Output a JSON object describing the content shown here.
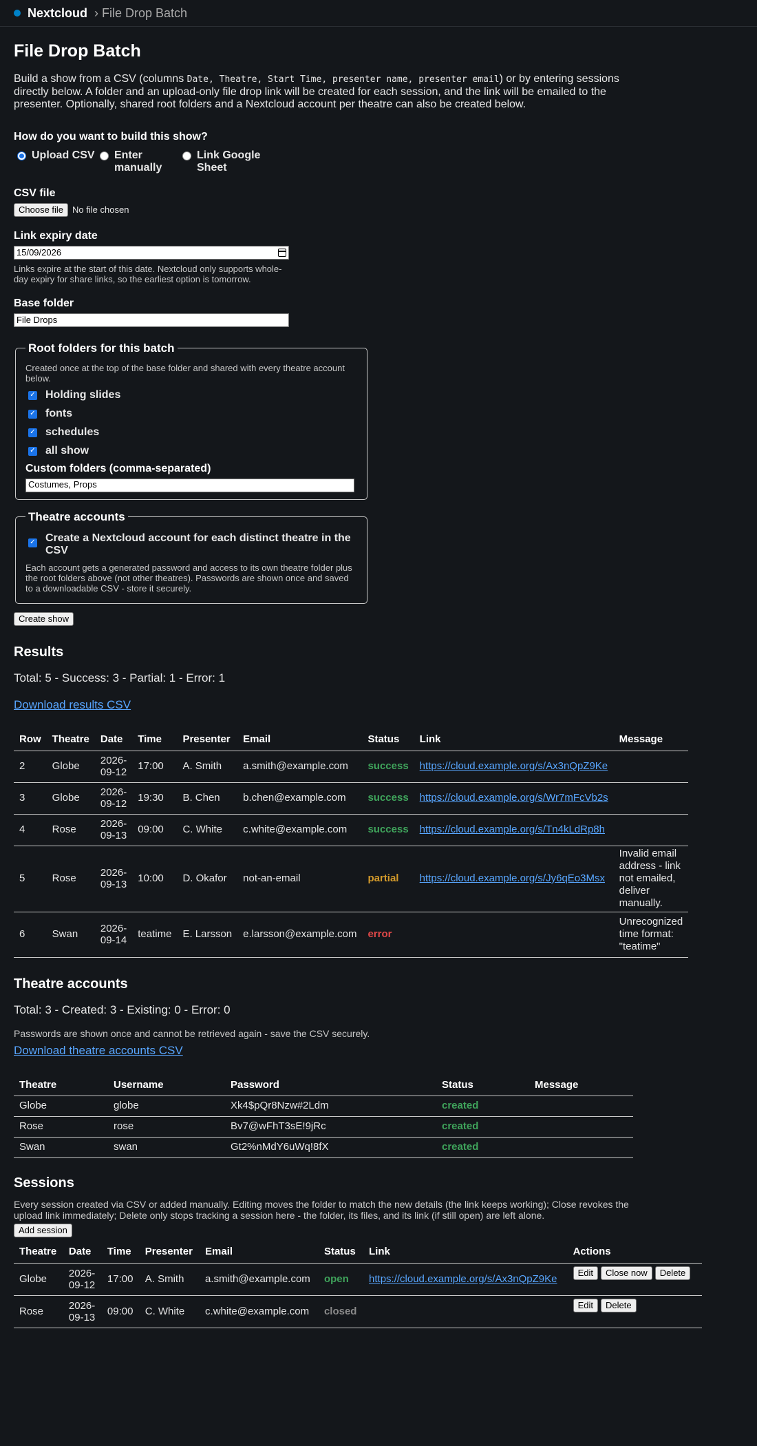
{
  "topbar": {
    "brand": "Nextcloud",
    "crumb": "› File Drop Batch"
  },
  "page": {
    "title": "File Drop Batch",
    "intro_a": "Build a show from a CSV (columns ",
    "intro_code": "Date, Theatre, Start Time, presenter name, presenter email",
    "intro_b": ") or by entering sessions directly below. A folder and an upload-only file drop link will be created for each session, and the link will be emailed to the presenter. Optionally, shared root folders and a Nextcloud account per theatre can also be created below."
  },
  "build": {
    "question": "How do you want to build this show?",
    "options": [
      {
        "label": "Upload CSV",
        "selected": true
      },
      {
        "label": "Enter manually",
        "selected": false
      },
      {
        "label": "Link Google Sheet",
        "selected": false
      }
    ]
  },
  "csv": {
    "label": "CSV file",
    "button": "Choose file",
    "status": "No file chosen"
  },
  "expiry": {
    "label": "Link expiry date",
    "value": "15/09/2026",
    "hint": "Links expire at the start of this date. Nextcloud only supports whole-day expiry for share links, so the earliest option is tomorrow."
  },
  "base": {
    "label": "Base folder",
    "value": "File Drops"
  },
  "roots": {
    "legend": "Root folders for this batch",
    "hint": "Created once at the top of the base folder and shared with every theatre account below.",
    "folders": [
      "Holding slides",
      "fonts",
      "schedules",
      "all show"
    ],
    "custom_label": "Custom folders (comma-separated)",
    "custom_value": "Costumes, Props"
  },
  "accounts_box": {
    "legend": "Theatre accounts",
    "checkbox": "Create a Nextcloud account for each distinct theatre in the CSV",
    "hint": "Each account gets a generated password and access to its own theatre folder plus the root folders above (not other theatres). Passwords are shown once and saved to a downloadable CSV - store it securely."
  },
  "create_button": "Create show",
  "results": {
    "title": "Results",
    "totals": "Total: 5 - Success: 3 - Partial: 1 - Error: 1",
    "download": "Download results CSV",
    "headers": [
      "Row",
      "Theatre",
      "Date",
      "Time",
      "Presenter",
      "Email",
      "Status",
      "Link",
      "Message"
    ],
    "rows": [
      {
        "row": "2",
        "theatre": "Globe",
        "date": "2026-09-12",
        "time": "17:00",
        "presenter": "A. Smith",
        "email": "a.smith@example.com",
        "status": "success",
        "link": "https://cloud.example.org/s/Ax3nQpZ9Ke",
        "message": ""
      },
      {
        "row": "3",
        "theatre": "Globe",
        "date": "2026-09-12",
        "time": "19:30",
        "presenter": "B. Chen",
        "email": "b.chen@example.com",
        "status": "success",
        "link": "https://cloud.example.org/s/Wr7mFcVb2s",
        "message": ""
      },
      {
        "row": "4",
        "theatre": "Rose",
        "date": "2026-09-13",
        "time": "09:00",
        "presenter": "C. White",
        "email": "c.white@example.com",
        "status": "success",
        "link": "https://cloud.example.org/s/Tn4kLdRp8h",
        "message": ""
      },
      {
        "row": "5",
        "theatre": "Rose",
        "date": "2026-09-13",
        "time": "10:00",
        "presenter": "D. Okafor",
        "email": "not-an-email",
        "status": "partial",
        "link": "https://cloud.example.org/s/Jy6qEo3Msx",
        "message": "Invalid email address - link not emailed, deliver manually."
      },
      {
        "row": "6",
        "theatre": "Swan",
        "date": "2026-09-14",
        "time": "teatime",
        "presenter": "E. Larsson",
        "email": "e.larsson@example.com",
        "status": "error",
        "link": "",
        "message": "Unrecognized time format: \"teatime\""
      }
    ]
  },
  "accounts": {
    "title": "Theatre accounts",
    "totals": "Total: 3 - Created: 3 - Existing: 0 - Error: 0",
    "note": "Passwords are shown once and cannot be retrieved again - save the CSV securely.",
    "download": "Download theatre accounts CSV",
    "headers": [
      "Theatre",
      "Username",
      "Password",
      "Status",
      "Message"
    ],
    "rows": [
      {
        "theatre": "Globe",
        "username": "globe",
        "password": "Xk4$pQr8Nzw#2Ldm",
        "status": "created",
        "message": ""
      },
      {
        "theatre": "Rose",
        "username": "rose",
        "password": "Bv7@wFhT3sE!9jRc",
        "status": "created",
        "message": ""
      },
      {
        "theatre": "Swan",
        "username": "swan",
        "password": "Gt2%nMdY6uWq!8fX",
        "status": "created",
        "message": ""
      }
    ]
  },
  "sessions": {
    "title": "Sessions",
    "note": "Every session created via CSV or added manually. Editing moves the folder to match the new details (the link keeps working); Close revokes the upload link immediately; Delete only stops tracking a session here - the folder, its files, and its link (if still open) are left alone.",
    "add_button": "Add session",
    "headers": [
      "Theatre",
      "Date",
      "Time",
      "Presenter",
      "Email",
      "Status",
      "Link",
      "Actions"
    ],
    "rows": [
      {
        "theatre": "Globe",
        "date": "2026-09-12",
        "time": "17:00",
        "presenter": "A. Smith",
        "email": "a.smith@example.com",
        "status": "open",
        "link": "https://cloud.example.org/s/Ax3nQpZ9Ke",
        "actions": [
          "Edit",
          "Close now",
          "Delete"
        ]
      },
      {
        "theatre": "Rose",
        "date": "2026-09-13",
        "time": "09:00",
        "presenter": "C. White",
        "email": "c.white@example.com",
        "status": "closed",
        "link": "",
        "actions": [
          "Edit",
          "Delete"
        ]
      }
    ]
  }
}
